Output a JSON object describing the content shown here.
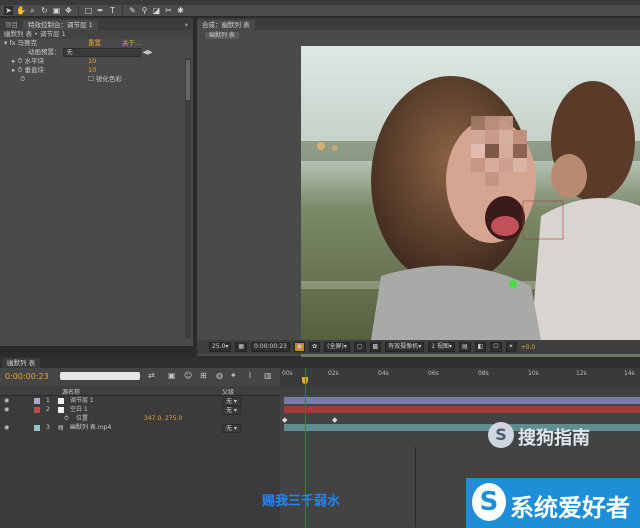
{
  "toolbar": {
    "tools": [
      "selection-tool",
      "hand-tool",
      "zoom-tool",
      "rotate-tool",
      "camera-tool",
      "pan-behind-tool",
      "rectangle-tool",
      "pen-tool",
      "text-tool",
      "brush-tool",
      "clone-tool",
      "eraser-tool",
      "roto-tool",
      "puppet-tool"
    ]
  },
  "left_panel": {
    "tabs": {
      "project": "项目",
      "effects": "特效控制台：调节层 1",
      "close": "▾"
    },
    "breadcrumb": "幽默列 表 • 调节层 1",
    "effect_name": "马赛克",
    "reset_label": "重置",
    "about_label": "关于...",
    "anim_preset_label": "动画预置：",
    "anim_preset_value": "无",
    "h_blocks_label": "水平块",
    "h_blocks_value": "10",
    "v_blocks_label": "垂直块",
    "v_blocks_value": "10",
    "sharpen_label": "锐化色彩"
  },
  "comp_panel": {
    "tab": "合成：幽默列 表",
    "subtab": "幽默列 表"
  },
  "comp_footer": {
    "zoom": "25.0",
    "timecode": "0:00:00:23",
    "resolution": "(全屏)",
    "camera": "有效摄像机",
    "views": "1 视图",
    "exposure": "+0.0"
  },
  "timeline": {
    "tab": "幽默列 表",
    "timecode": "0:00:00:23",
    "search_placeholder": "",
    "col_source": "源名称",
    "col_parent": "父级",
    "ruler": [
      "00s",
      "02s",
      "04s",
      "06s",
      "08s",
      "10s",
      "12s",
      "14s"
    ],
    "layers": [
      {
        "num": "1",
        "name": "调节层 1",
        "parent": "无",
        "color": "#a7a7c8"
      },
      {
        "num": "2",
        "name": "空白 1",
        "parent": "无",
        "color": "#c04848"
      },
      {
        "num": "",
        "name": "位置",
        "value": "347.0, 275.0",
        "parent": "",
        "color": ""
      },
      {
        "num": "3",
        "name": "幽默列 表.mp4",
        "parent": "无",
        "color": "#8ec6c6"
      }
    ]
  },
  "watermarks": {
    "sogou": "搜狗指南",
    "site": "系统爱好者",
    "caption": "赐我三千弱水"
  },
  "colors": {
    "accent": "#e8a531",
    "bg": "#2b2b2b",
    "panel": "#4a4a4a"
  }
}
